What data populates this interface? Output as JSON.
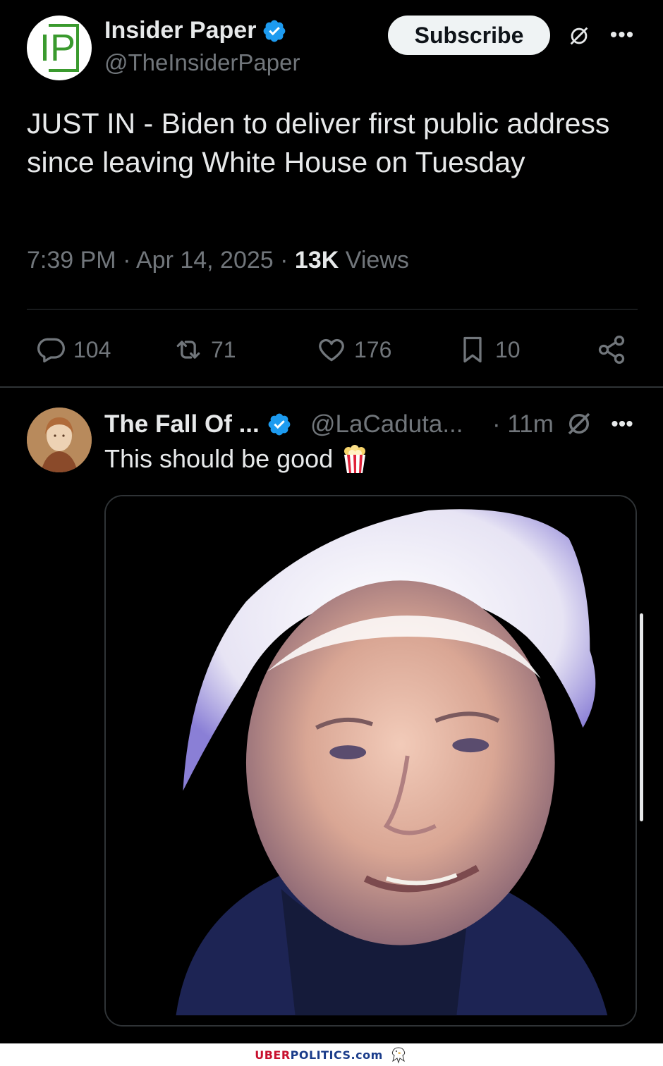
{
  "main_tweet": {
    "author": {
      "name": "Insider Paper",
      "handle": "@TheInsiderPaper",
      "avatar_text": "IP",
      "verified": true
    },
    "subscribe_label": "Subscribe",
    "text": "JUST IN - Biden to deliver first public address since leaving White House on Tuesday",
    "time": "7:39 PM",
    "date": "Apr 14, 2025",
    "views_count": "13K",
    "views_label": "Views",
    "actions": {
      "replies": "104",
      "reposts": "71",
      "likes": "176",
      "bookmarks": "10"
    }
  },
  "reply": {
    "author": {
      "name": "The Fall Of ...",
      "handle": "@LaCaduta...",
      "verified": true
    },
    "time": "· 11m",
    "text": "This should be good"
  },
  "footer": {
    "uber": "UBER",
    "politics": "POLITICS",
    "dotcom": ".com"
  },
  "colors": {
    "background": "#000000",
    "text_primary": "#e7e9ea",
    "text_secondary": "#71767b",
    "verified_blue": "#1d9bf0",
    "divider": "#2f3336"
  }
}
